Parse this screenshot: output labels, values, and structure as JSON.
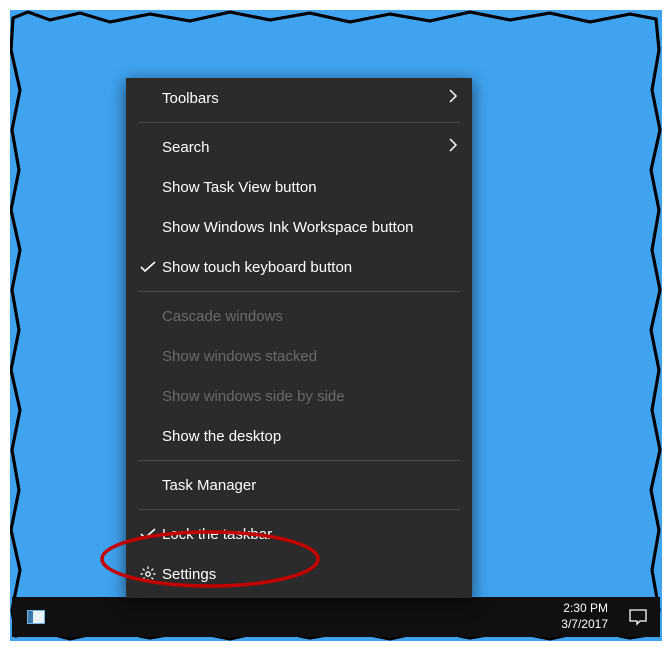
{
  "menu": {
    "items": [
      {
        "label": "Toolbars",
        "submenu": true
      },
      {
        "label": "Search",
        "submenu": true
      },
      {
        "label": "Show Task View button"
      },
      {
        "label": "Show Windows Ink Workspace button"
      },
      {
        "label": "Show touch keyboard button",
        "checked": true
      },
      {
        "label": "Cascade windows",
        "disabled": true
      },
      {
        "label": "Show windows stacked",
        "disabled": true
      },
      {
        "label": "Show windows side by side",
        "disabled": true
      },
      {
        "label": "Show the desktop"
      },
      {
        "label": "Task Manager"
      },
      {
        "label": "Lock the taskbar",
        "checked": true
      },
      {
        "label": "Settings",
        "icon": "gear"
      }
    ]
  },
  "taskbar": {
    "time": "2:30 PM",
    "date": "3/7/2017"
  },
  "highlight": {
    "target_label": "Lock the taskbar",
    "color": "#c40000"
  }
}
